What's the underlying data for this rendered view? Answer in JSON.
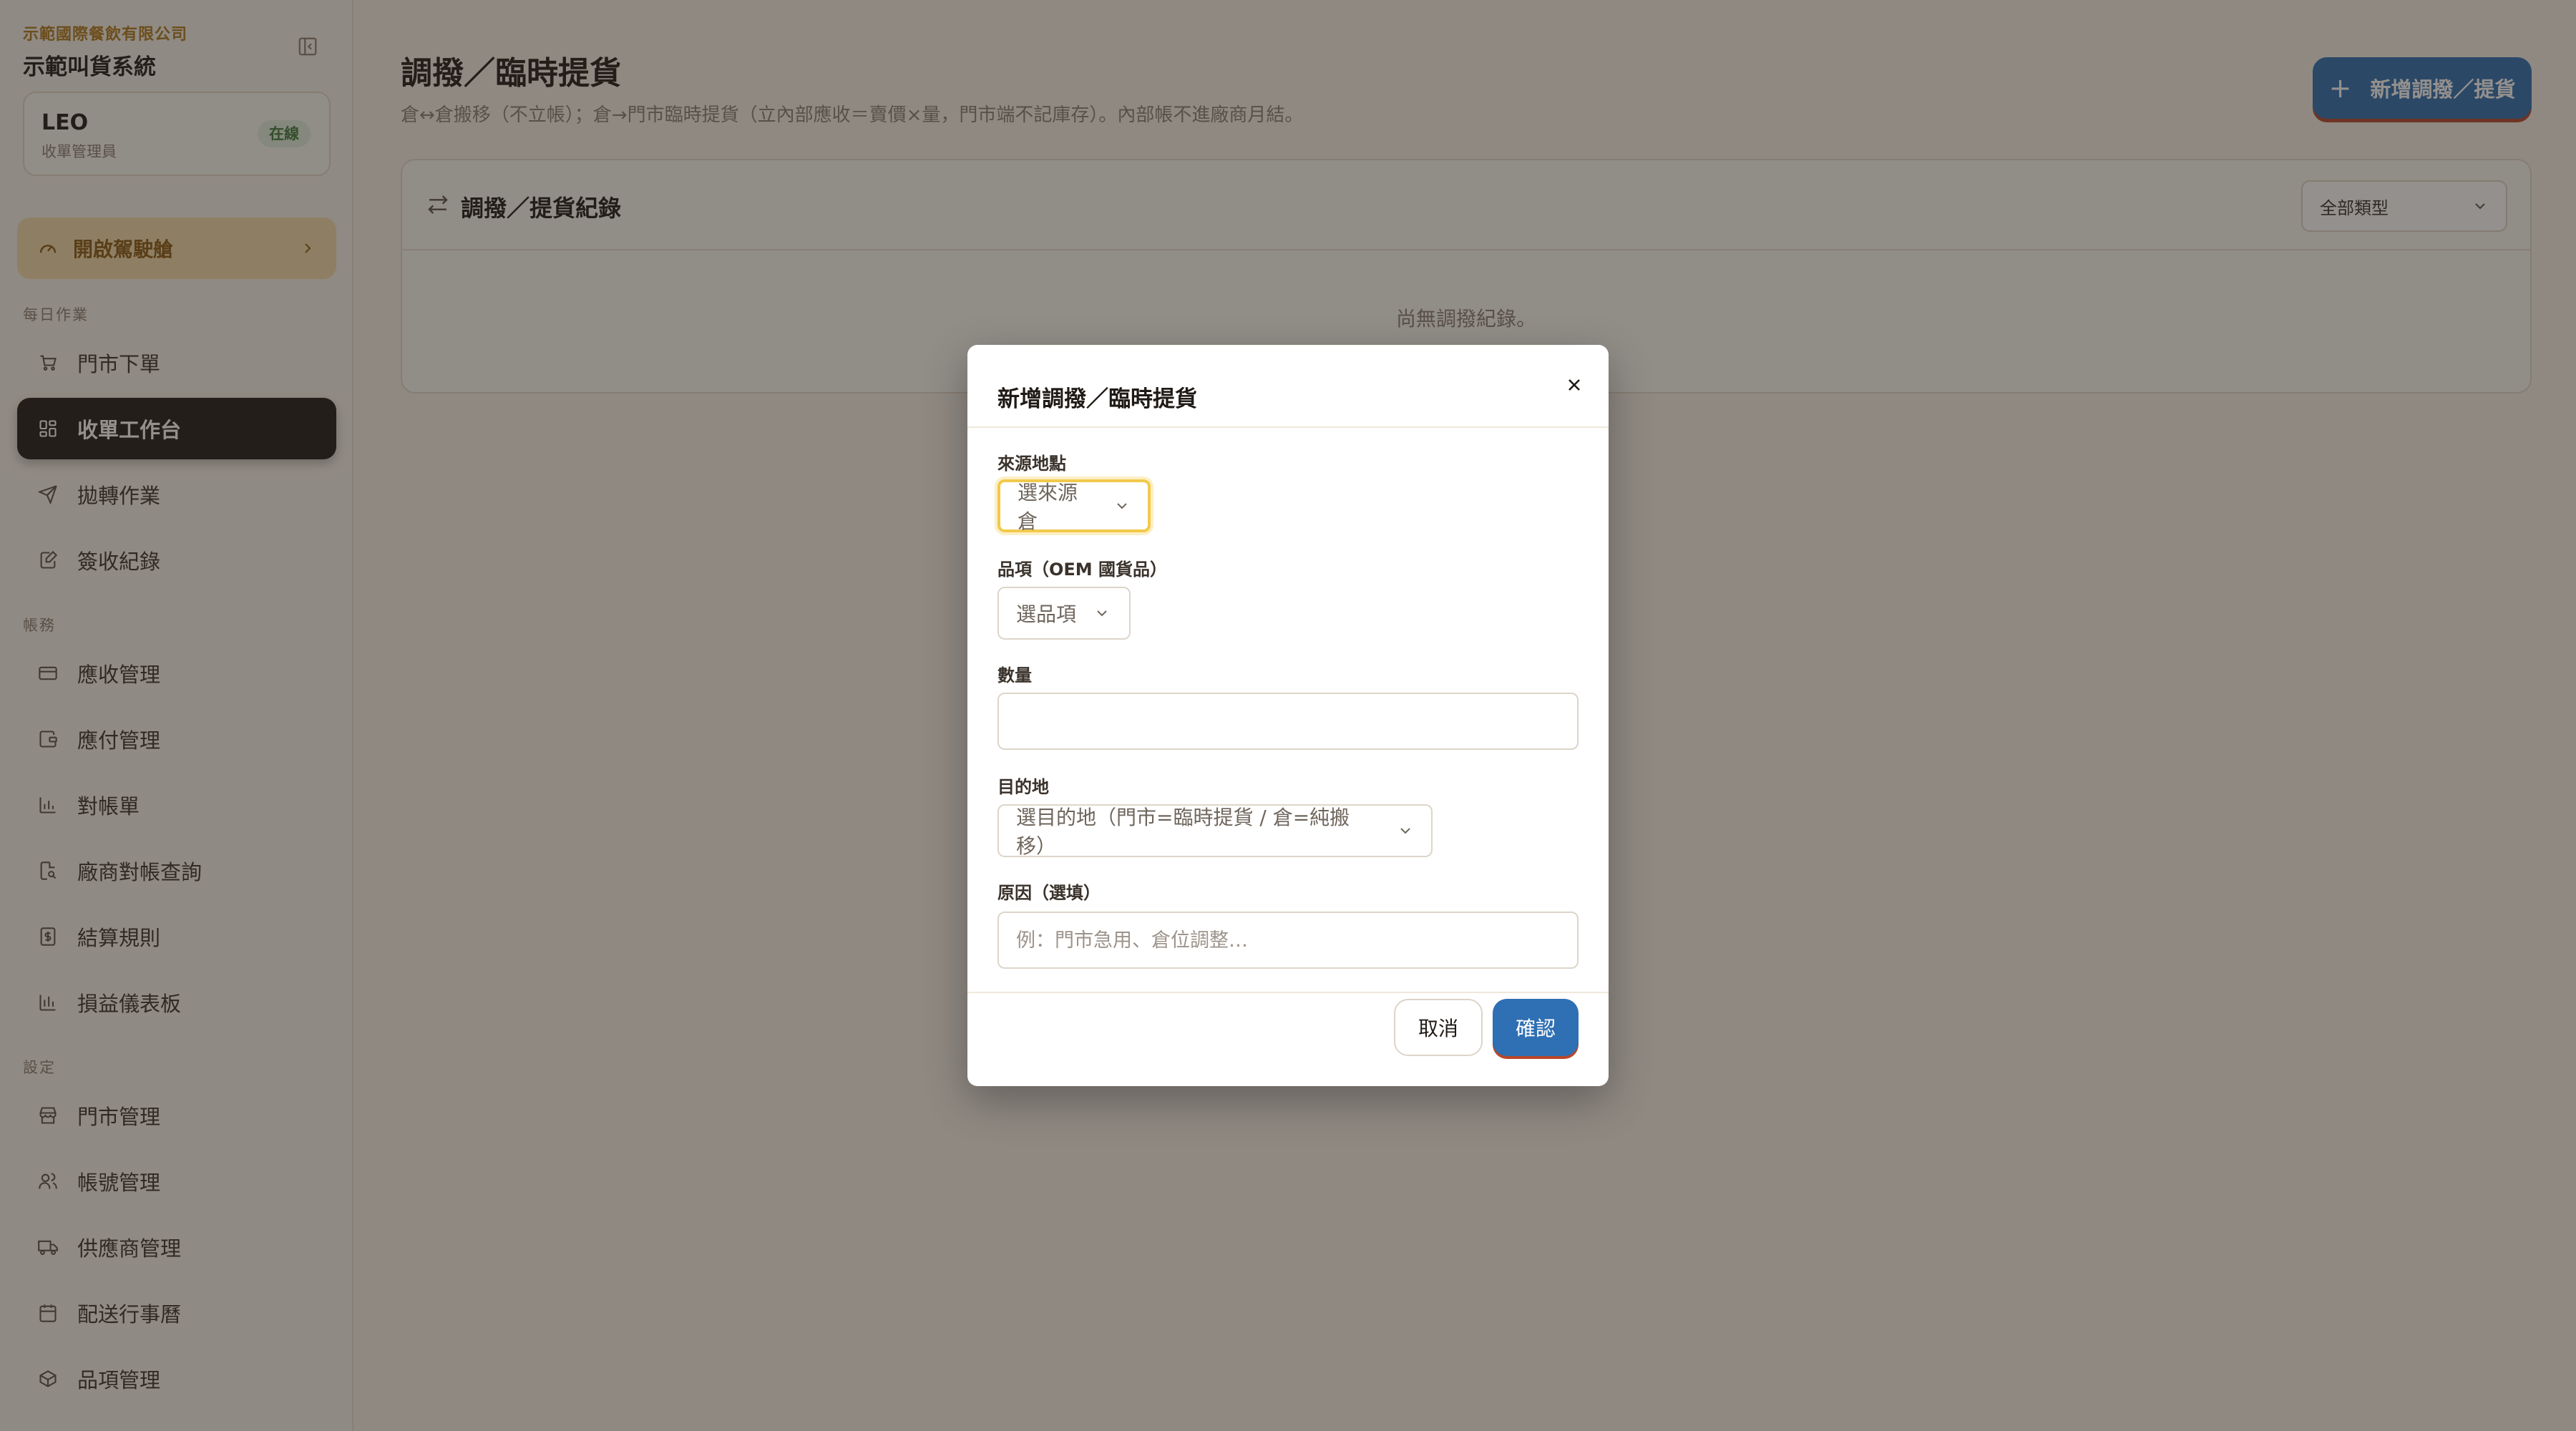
{
  "sidebar": {
    "company": "示範國際餐飲有限公司",
    "system_name": "示範叫貨系統",
    "user": {
      "name": "LEO",
      "role": "收單管理員",
      "status": "在線"
    },
    "cockpit": {
      "label": "開啟駕駛艙",
      "icon": "gauge-icon"
    },
    "sections": [
      {
        "label": "每日作業",
        "items": [
          {
            "label": "門市下單",
            "icon": "cart-icon"
          },
          {
            "label": "收單工作台",
            "icon": "grid-icon",
            "active": true
          },
          {
            "label": "拋轉作業",
            "icon": "send-icon"
          },
          {
            "label": "簽收紀錄",
            "icon": "sign-icon"
          }
        ]
      },
      {
        "label": "帳務",
        "items": [
          {
            "label": "應收管理",
            "icon": "card-icon"
          },
          {
            "label": "應付管理",
            "icon": "wallet-icon"
          },
          {
            "label": "對帳單",
            "icon": "bar-chart-icon"
          },
          {
            "label": "廠商對帳查詢",
            "icon": "file-search-icon"
          },
          {
            "label": "結算規則",
            "icon": "receipt-icon"
          },
          {
            "label": "損益儀表板",
            "icon": "bar-chart-icon"
          }
        ]
      },
      {
        "label": "設定",
        "items": [
          {
            "label": "門市管理",
            "icon": "store-icon"
          },
          {
            "label": "帳號管理",
            "icon": "users-icon"
          },
          {
            "label": "供應商管理",
            "icon": "truck-icon"
          },
          {
            "label": "配送行事曆",
            "icon": "calendar-icon"
          },
          {
            "label": "品項管理",
            "icon": "package-icon"
          }
        ]
      }
    ]
  },
  "main": {
    "title": "調撥／臨時提貨",
    "subtitle": "倉↔倉搬移（不立帳）；倉→門市臨時提貨（立內部應收＝賣價×量，門市端不記庫存）。內部帳不進廠商月結。",
    "add_button": "新增調撥／提貨",
    "records": {
      "title": "調撥／提貨紀錄",
      "filter_value": "全部類型",
      "empty_text": "尚無調撥紀錄。"
    }
  },
  "modal": {
    "title": "新增調撥／臨時提貨",
    "source": {
      "label": "來源地點",
      "placeholder": "選來源倉"
    },
    "item": {
      "label": "品項（OEM 國貨品）",
      "placeholder": "選品項"
    },
    "quantity": {
      "label": "數量",
      "value": ""
    },
    "destination": {
      "label": "目的地",
      "placeholder": "選目的地（門市=臨時提貨 / 倉=純搬移）"
    },
    "reason": {
      "label": "原因（選填）",
      "placeholder": "例：門市急用、倉位調整…"
    },
    "cancel": "取消",
    "confirm": "確認"
  },
  "colors": {
    "accent": "#2f6fb3",
    "sidebar_active": "#1f1a16",
    "cockpit": "#f4dcad",
    "focus_ring": "#f2c94c",
    "online": "#3e7b3a"
  }
}
